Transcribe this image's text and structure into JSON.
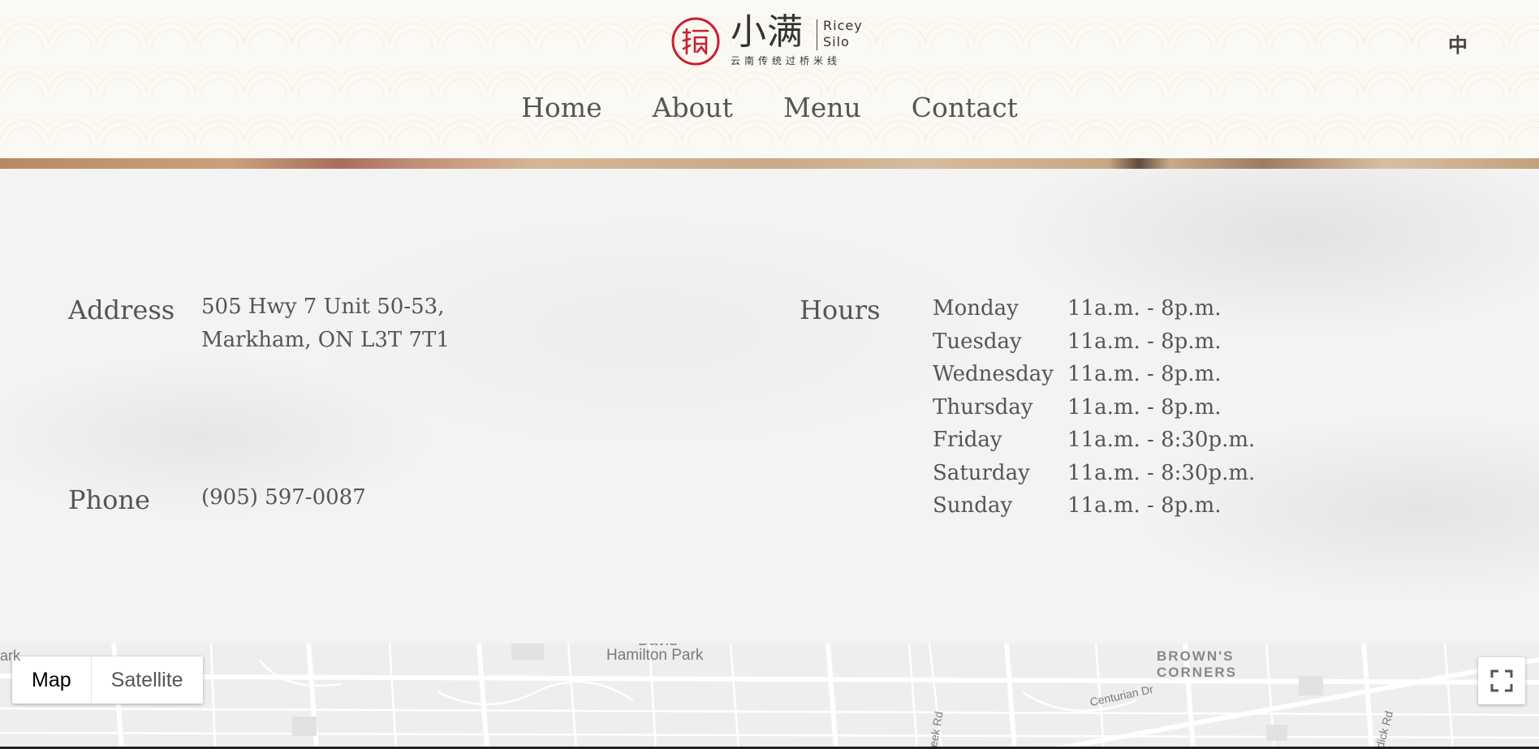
{
  "header": {
    "logo": {
      "cn_name": "小满",
      "en_name_line1": "Ricey",
      "en_name_line2": "Silo",
      "subtitle": "云南传统过桥米线",
      "brand_color": "#c8202f"
    },
    "language_toggle": "中",
    "nav": [
      {
        "label": "Home"
      },
      {
        "label": "About"
      },
      {
        "label": "Menu"
      },
      {
        "label": "Contact"
      }
    ]
  },
  "contact": {
    "address_label": "Address",
    "address_line1": "505 Hwy 7 Unit 50-53,",
    "address_line2": "Markham, ON L3T 7T1",
    "phone_label": "Phone",
    "phone": "(905) 597-0087",
    "hours_label": "Hours",
    "hours": [
      {
        "day": "Monday",
        "time": "11a.m. - 8p.m."
      },
      {
        "day": "Tuesday",
        "time": "11a.m. - 8p.m."
      },
      {
        "day": "Wednesday",
        "time": "11a.m. - 8p.m."
      },
      {
        "day": "Thursday",
        "time": "11a.m. - 8p.m."
      },
      {
        "day": "Friday",
        "time": "11a.m. - 8:30p.m."
      },
      {
        "day": "Saturday",
        "time": "11a.m. - 8:30p.m."
      },
      {
        "day": "Sunday",
        "time": "11a.m. - 8p.m."
      }
    ]
  },
  "map": {
    "map_type_options": [
      "Map",
      "Satellite"
    ],
    "selected_map_type": "Map",
    "fullscreen_icon": "fullscreen-icon",
    "labels": {
      "park_top": "David",
      "park": "Hamilton Park",
      "area_line1": "BROWN'S",
      "area_line2": "CORNERS",
      "street1": "Centurian Dr",
      "street2": "reek Rd",
      "street3": "dick Rd",
      "edge_left": "ark"
    }
  }
}
